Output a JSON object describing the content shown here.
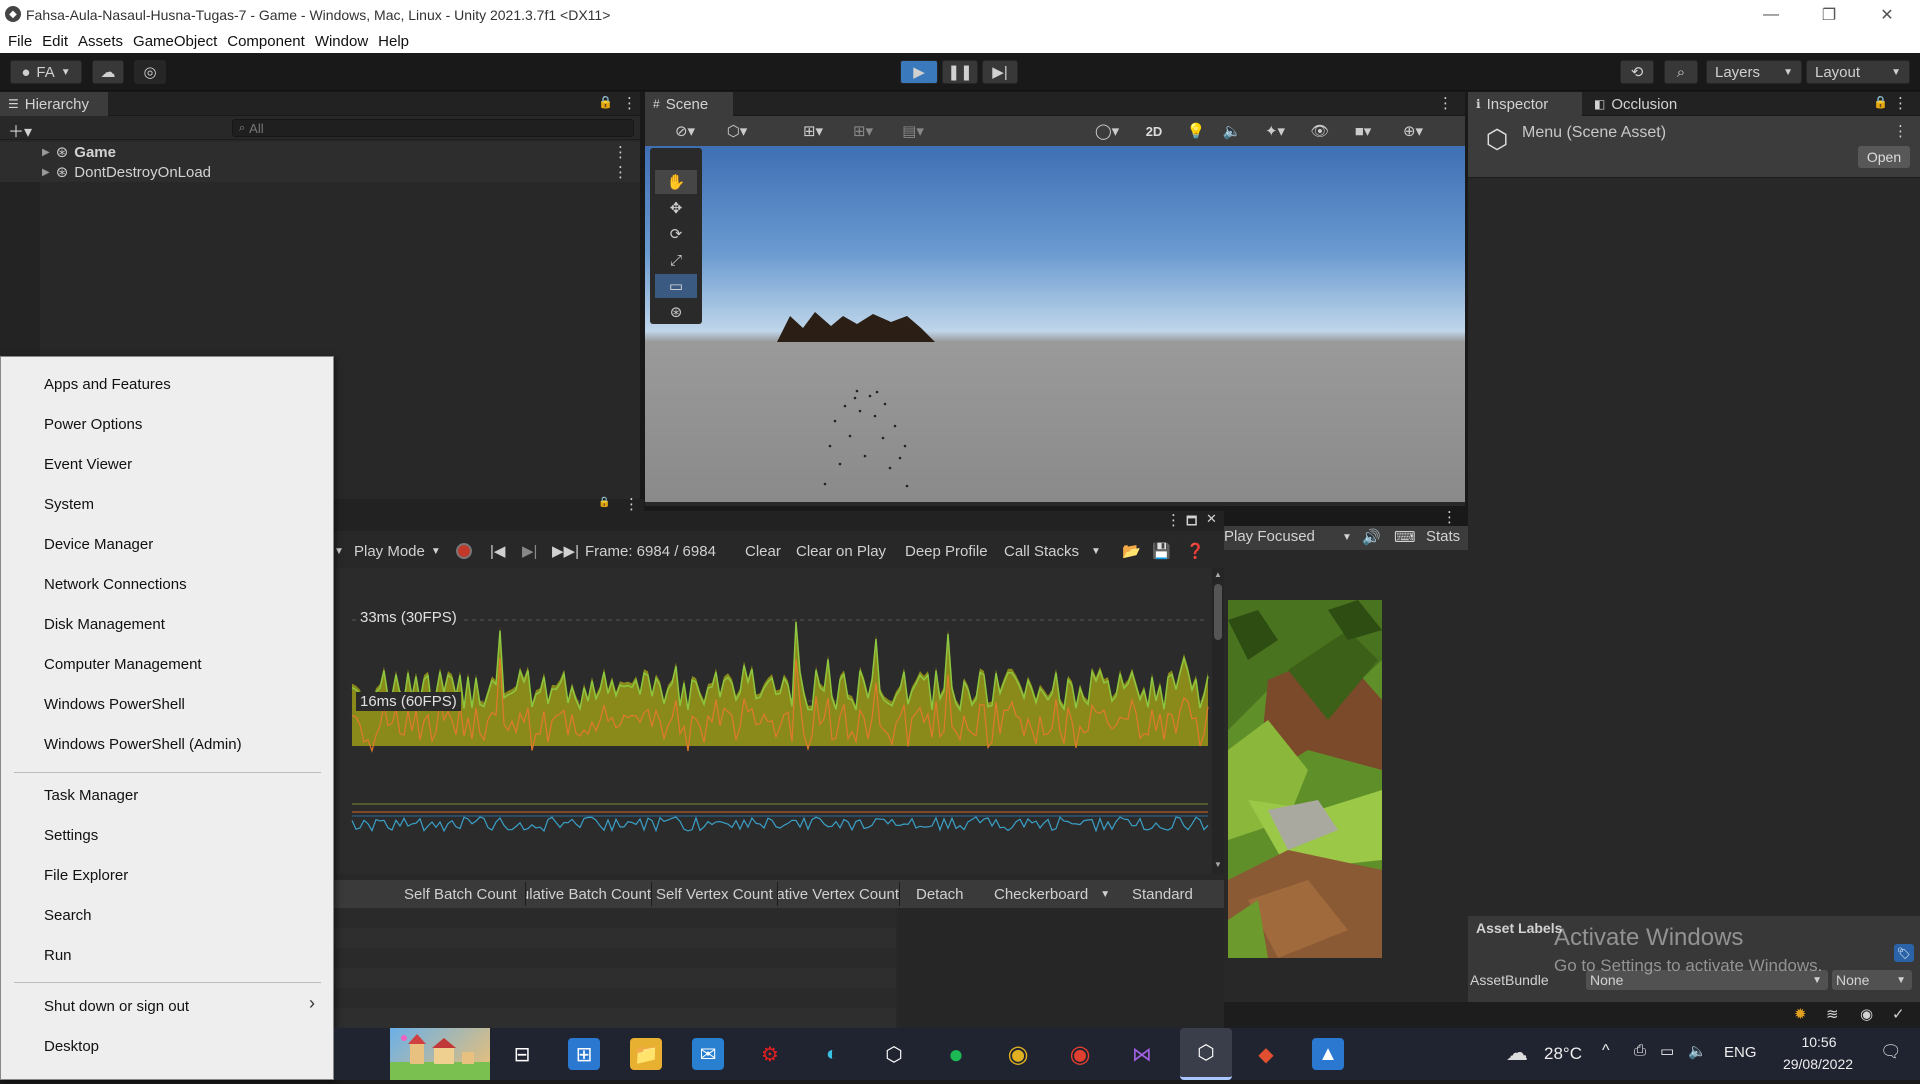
{
  "window": {
    "title": "Fahsa-Aula-Nasaul-Husna-Tugas-7 - Game - Windows, Mac, Linux - Unity 2021.3.7f1 <DX11>",
    "minimize_icon": "minimize-icon",
    "maximize_icon": "restore-icon",
    "close_icon": "close-icon"
  },
  "menubar": [
    "File",
    "Edit",
    "Assets",
    "GameObject",
    "Component",
    "Window",
    "Help"
  ],
  "toolbar": {
    "account": "FA",
    "layers": "Layers",
    "layout": "Layout"
  },
  "hierarchy": {
    "tab": "Hierarchy",
    "search_placeholder": "All",
    "items": [
      "Game",
      "DontDestroyOnLoad"
    ]
  },
  "scene": {
    "tab": "Scene",
    "mode_2d": "2D"
  },
  "inspector": {
    "tab": "Inspector",
    "occlusion_tab": "Occlusion",
    "asset_title": "Menu (Scene Asset)",
    "open_button": "Open",
    "asset_labels": "Asset Labels",
    "asset_bundle_label": "AssetBundle",
    "asset_bundle_value": "None",
    "asset_bundle_variant": "None"
  },
  "profiler": {
    "play_mode": "Play Mode",
    "frame": "Frame: 6984 / 6984",
    "clear": "Clear",
    "clear_on_play": "Clear on Play",
    "deep_profile": "Deep Profile",
    "call_stacks": "Call Stacks",
    "label_33": "33ms (30FPS)",
    "label_16": "16ms (60FPS)",
    "columns": [
      "Self Batch Count",
      "Cumulative Batch Count",
      "Self Vertex Count",
      "Cumulative Vertex Count"
    ],
    "detach": "Detach",
    "checkerboard": "Checkerboard",
    "standard": "Standard"
  },
  "game": {
    "play_focused": "Play Focused",
    "stats": "Stats"
  },
  "watermark": {
    "line1": "Activate Windows",
    "line2": "Go to Settings to activate Windows."
  },
  "context_menu": {
    "group1": [
      "Apps and Features",
      "Power Options",
      "Event Viewer",
      "System",
      "Device Manager",
      "Network Connections",
      "Disk Management",
      "Computer Management",
      "Windows PowerShell",
      "Windows PowerShell (Admin)"
    ],
    "group2": [
      "Task Manager",
      "Settings",
      "File Explorer",
      "Search",
      "Run"
    ],
    "group3": [
      "Shut down or sign out",
      "Desktop"
    ]
  },
  "taskbar": {
    "weather": "28°C",
    "language": "ENG",
    "time": "10:56",
    "date": "29/08/2022"
  },
  "colors": {
    "accent": "#3a79bb",
    "graph_fill": "#8a8a1a",
    "graph_green": "#8dc63f",
    "graph_orange": "#e07a2a",
    "sky_top": "#3f6fb4",
    "ground": "#8a8a8a"
  }
}
